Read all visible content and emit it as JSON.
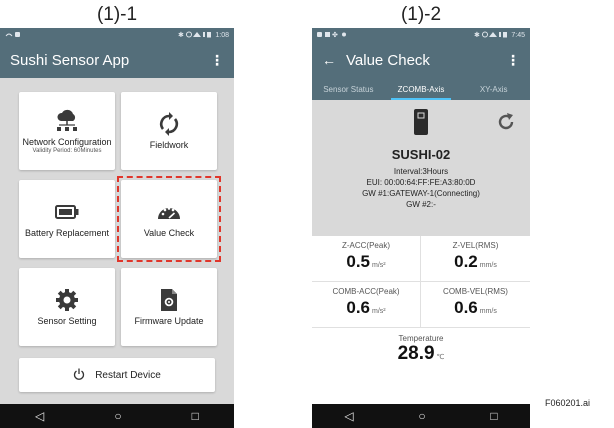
{
  "captions": {
    "left": "(1)-1",
    "right": "(1)-2"
  },
  "screen1": {
    "status": {
      "time": "1:08"
    },
    "appbar": {
      "title": "Sushi Sensor App",
      "menu_icon": "more-vert-icon"
    },
    "tiles": [
      {
        "label": "Network Configuration",
        "sub": "Validity Period: 60Minutes",
        "icon": "network-cloud-icon"
      },
      {
        "label": "Fieldwork",
        "icon": "sync-icon"
      },
      {
        "label": "Battery Replacement",
        "icon": "battery-icon"
      },
      {
        "label": "Value Check",
        "icon": "gauge-icon"
      },
      {
        "label": "Sensor Setting",
        "icon": "gear-icon"
      },
      {
        "label": "Firmware Update",
        "icon": "firmware-file-icon"
      }
    ],
    "restart": {
      "label": "Restart Device",
      "icon": "power-icon"
    },
    "highlight_color": "#e0362b"
  },
  "screen2": {
    "status": {
      "time": "7:45"
    },
    "appbar": {
      "title": "Value Check",
      "back_icon": "back-arrow-icon",
      "menu_icon": "more-vert-icon"
    },
    "tabs": [
      {
        "label": "Sensor Status",
        "active": false
      },
      {
        "label": "ZCOMB-Axis",
        "active": true
      },
      {
        "label": "XY-Axis",
        "active": false
      }
    ],
    "device": {
      "name": "SUSHI-02",
      "interval": "Interval:3Hours",
      "eui": "EUI: 00:00:64:FF:FE:A3:80:0D",
      "gw1": "GW #1:GATEWAY-1(Connecting)",
      "gw2": "GW #2:-"
    },
    "values": [
      {
        "label": "Z-ACC(Peak)",
        "value": "0.5",
        "unit": "m/s²"
      },
      {
        "label": "Z-VEL(RMS)",
        "value": "0.2",
        "unit": "mm/s"
      },
      {
        "label": "COMB-ACC(Peak)",
        "value": "0.6",
        "unit": "m/s²"
      },
      {
        "label": "COMB-VEL(RMS)",
        "value": "0.6",
        "unit": "mm/s"
      }
    ],
    "temperature": {
      "label": "Temperature",
      "value": "28.9",
      "unit": "℃"
    }
  },
  "nav": {
    "back": "◁",
    "home": "○",
    "recent": "□"
  },
  "figure_id": "F060201.ai",
  "colors": {
    "appbar": "#546e7a",
    "tab_indicator": "#4fc3f7",
    "screen_bg": "#d9d9d9"
  }
}
